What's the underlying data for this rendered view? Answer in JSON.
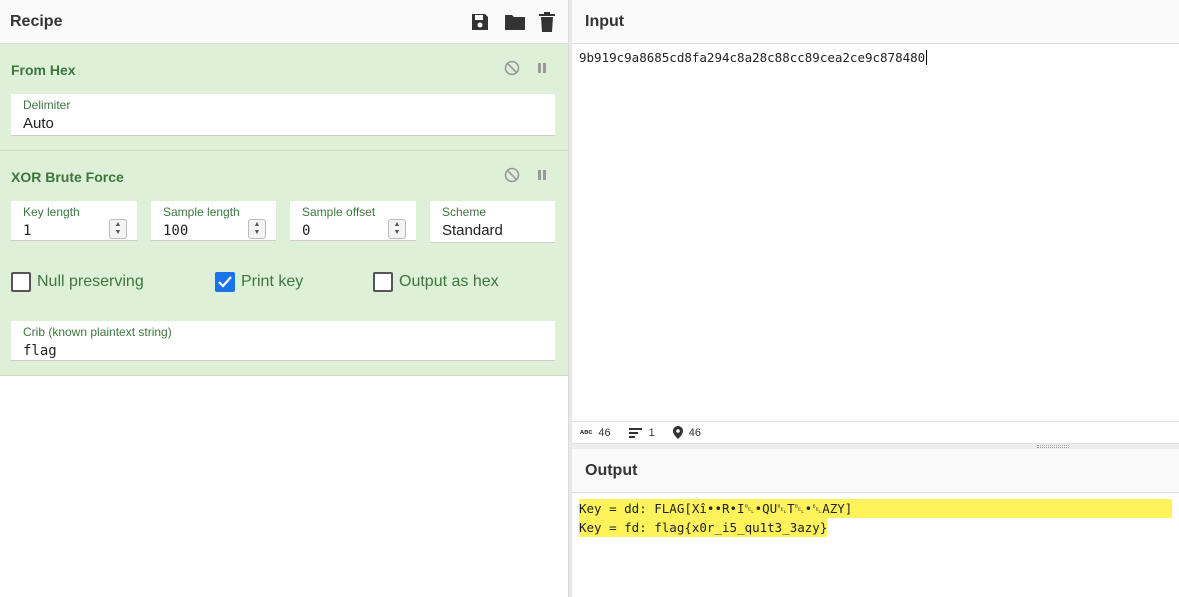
{
  "recipe": {
    "title": "Recipe",
    "icons": [
      "save-icon",
      "folder-icon",
      "trash-icon"
    ]
  },
  "operations": {
    "from_hex": {
      "title": "From Hex",
      "delimiter_label": "Delimiter",
      "delimiter_value": "Auto"
    },
    "xor": {
      "title": "XOR Brute Force",
      "key_length_label": "Key length",
      "key_length_value": "1",
      "sample_length_label": "Sample length",
      "sample_length_value": "100",
      "sample_offset_label": "Sample offset",
      "sample_offset_value": "0",
      "scheme_label": "Scheme",
      "scheme_value": "Standard",
      "null_preserving_label": "Null preserving",
      "null_preserving_checked": false,
      "print_key_label": "Print key",
      "print_key_checked": true,
      "output_hex_label": "Output as hex",
      "output_hex_checked": false,
      "crib_label": "Crib (known plaintext string)",
      "crib_value": "flag"
    }
  },
  "input": {
    "title": "Input",
    "text": "9b919c9a8685cd8fa294c8a28c88cc89cea2ce9c878480",
    "status": {
      "chars": "46",
      "lines": "1",
      "position": "46"
    }
  },
  "output": {
    "title": "Output",
    "line1": "Key = dd: FLAG[Xî••R•I␇•QU␇T␇•␇AZY]",
    "line2": "Key = fd: flag{x0r_i5_qu1t3_3azy}"
  },
  "colors": {
    "accent_green": "#3c763d",
    "op_bg": "#dff0d8",
    "highlight": "#fff35c",
    "checkbox_blue": "#1a73e8"
  }
}
